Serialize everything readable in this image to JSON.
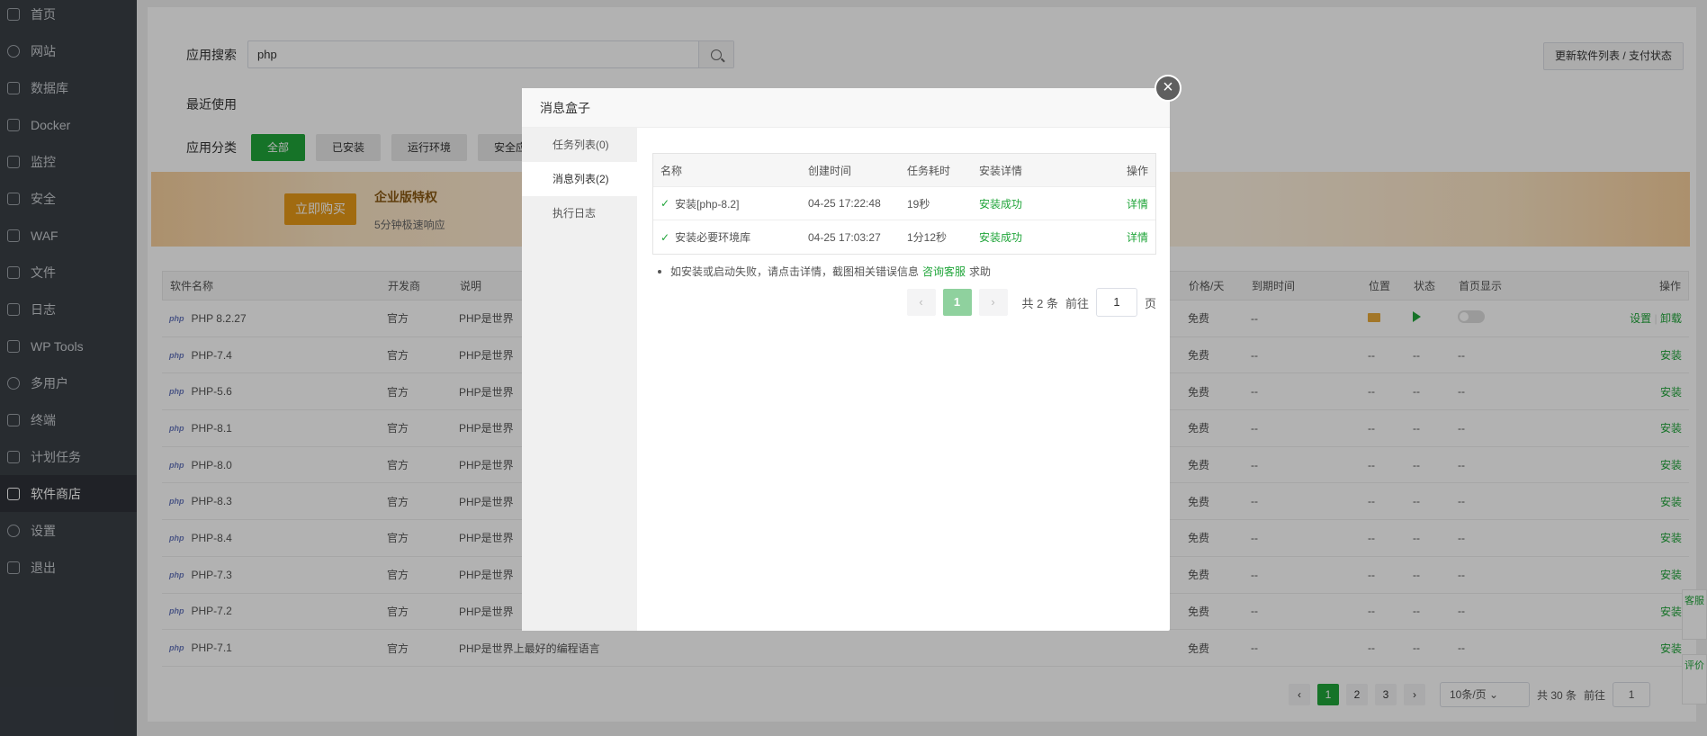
{
  "sidebar": {
    "items": [
      {
        "label": "首页",
        "icon": "home-icon"
      },
      {
        "label": "网站",
        "icon": "globe-icon"
      },
      {
        "label": "数据库",
        "icon": "database-icon"
      },
      {
        "label": "Docker",
        "icon": "docker-icon"
      },
      {
        "label": "监控",
        "icon": "monitor-icon"
      },
      {
        "label": "安全",
        "icon": "shield-icon"
      },
      {
        "label": "WAF",
        "icon": "waf-shield-icon"
      },
      {
        "label": "文件",
        "icon": "folder-icon"
      },
      {
        "label": "日志",
        "icon": "log-icon"
      },
      {
        "label": "WP Tools",
        "icon": "wordpress-icon"
      },
      {
        "label": "多用户",
        "icon": "users-icon"
      },
      {
        "label": "终端",
        "icon": "terminal-icon"
      },
      {
        "label": "计划任务",
        "icon": "calendar-icon"
      },
      {
        "label": "软件商店",
        "icon": "grid-icon"
      },
      {
        "label": "设置",
        "icon": "gear-icon"
      },
      {
        "label": "退出",
        "icon": "logout-icon"
      }
    ]
  },
  "search": {
    "label": "应用搜索",
    "value": "php"
  },
  "update_button": "更新软件列表 / 支付状态",
  "recent_label": "最近使用",
  "categories": {
    "label": "应用分类",
    "items": [
      "全部",
      "已安装",
      "运行环境",
      "安全应"
    ]
  },
  "banner": {
    "buy": "立即购买",
    "title": "企业版特权",
    "sub": "5分钟极速响应"
  },
  "table": {
    "headers": [
      "软件名称",
      "开发商",
      "说明",
      "价格/天",
      "到期时间",
      "位置",
      "状态",
      "首页显示",
      "操作"
    ],
    "rows": [
      {
        "name": "PHP 8.2.27",
        "dev": "官方",
        "desc": "PHP是世界",
        "price": "免费",
        "exp": "--",
        "pos": "",
        "stat": "",
        "home": "",
        "op1": "设置",
        "op2": "卸载"
      },
      {
        "name": "PHP-7.4",
        "dev": "官方",
        "desc": "PHP是世界",
        "price": "免费",
        "exp": "--",
        "pos": "--",
        "stat": "--",
        "home": "--",
        "op1": "",
        "op2": "安装"
      },
      {
        "name": "PHP-5.6",
        "dev": "官方",
        "desc": "PHP是世界",
        "price": "免费",
        "exp": "--",
        "pos": "--",
        "stat": "--",
        "home": "--",
        "op1": "",
        "op2": "安装"
      },
      {
        "name": "PHP-8.1",
        "dev": "官方",
        "desc": "PHP是世界",
        "price": "免费",
        "exp": "--",
        "pos": "--",
        "stat": "--",
        "home": "--",
        "op1": "",
        "op2": "安装"
      },
      {
        "name": "PHP-8.0",
        "dev": "官方",
        "desc": "PHP是世界",
        "price": "免费",
        "exp": "--",
        "pos": "--",
        "stat": "--",
        "home": "--",
        "op1": "",
        "op2": "安装"
      },
      {
        "name": "PHP-8.3",
        "dev": "官方",
        "desc": "PHP是世界",
        "price": "免费",
        "exp": "--",
        "pos": "--",
        "stat": "--",
        "home": "--",
        "op1": "",
        "op2": "安装"
      },
      {
        "name": "PHP-8.4",
        "dev": "官方",
        "desc": "PHP是世界",
        "price": "免费",
        "exp": "--",
        "pos": "--",
        "stat": "--",
        "home": "--",
        "op1": "",
        "op2": "安装"
      },
      {
        "name": "PHP-7.3",
        "dev": "官方",
        "desc": "PHP是世界",
        "price": "免费",
        "exp": "--",
        "pos": "--",
        "stat": "--",
        "home": "--",
        "op1": "",
        "op2": "安装"
      },
      {
        "name": "PHP-7.2",
        "dev": "官方",
        "desc": "PHP是世界",
        "price": "免费",
        "exp": "--",
        "pos": "--",
        "stat": "--",
        "home": "--",
        "op1": "",
        "op2": "安装"
      },
      {
        "name": "PHP-7.1",
        "dev": "官方",
        "desc": "PHP是世界上最好的编程语言",
        "price": "免费",
        "exp": "--",
        "pos": "--",
        "stat": "--",
        "home": "--",
        "op1": "",
        "op2": "安装"
      }
    ],
    "php_logo": "php"
  },
  "pager": {
    "pages": [
      "1",
      "2",
      "3"
    ],
    "per_page": "10条/页",
    "total": "共 30 条",
    "goto": "前往",
    "goto_value": "1"
  },
  "side_tabs": [
    "客服",
    "评价"
  ],
  "dialog": {
    "title": "消息盒子",
    "tabs": [
      "任务列表(0)",
      "消息列表(2)",
      "执行日志"
    ],
    "headers": [
      "名称",
      "创建时间",
      "任务耗时",
      "安装详情",
      "操作"
    ],
    "rows": [
      {
        "name": "安装[php-8.2]",
        "time": "04-25 17:22:48",
        "cost": "19秒",
        "detail": "安装成功",
        "op": "详情"
      },
      {
        "name": "安装必要环境库",
        "time": "04-25 17:03:27",
        "cost": "1分12秒",
        "detail": "安装成功",
        "op": "详情"
      }
    ],
    "tip": "如安装或启动失败，请点击详情，截图相关错误信息",
    "tip_link": "咨询客服",
    "tip_end": "求助",
    "pager": {
      "page": "1",
      "total": "共 2 条",
      "goto": "前往",
      "goto_value": "1",
      "unit": "页"
    }
  },
  "colors": {
    "accent": "#20a53a",
    "sidebar": "#3a3f46"
  }
}
